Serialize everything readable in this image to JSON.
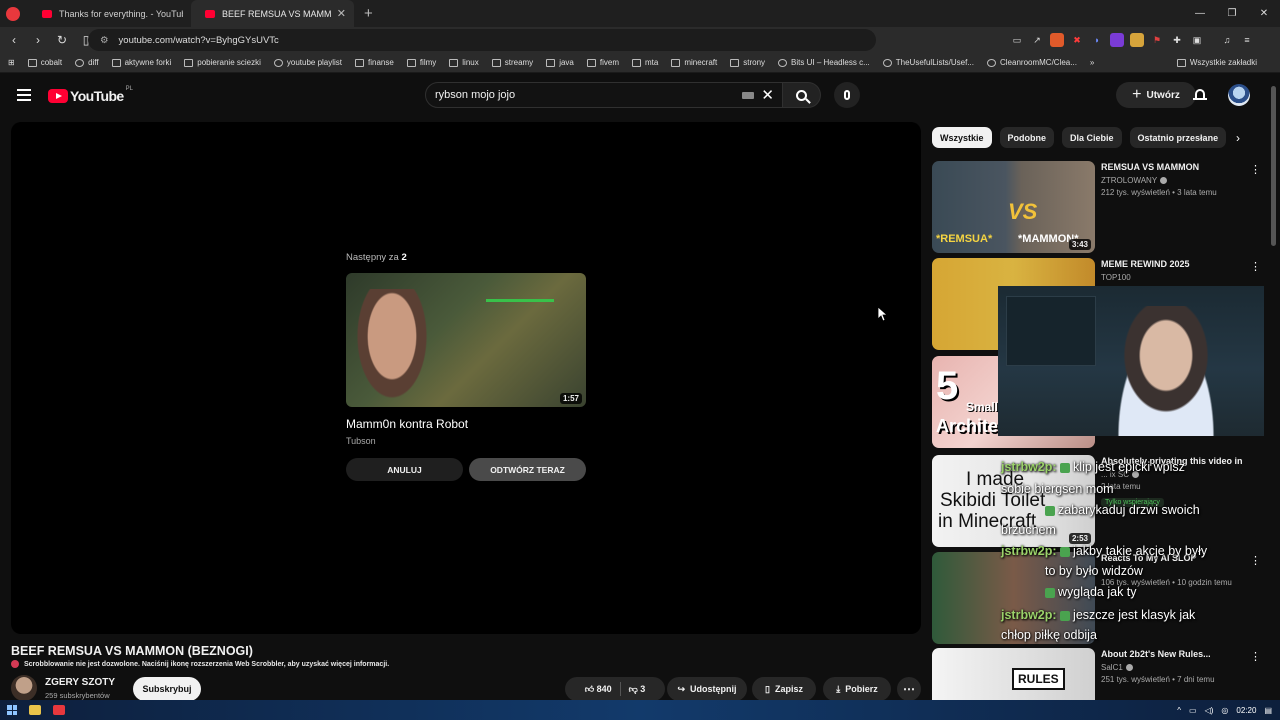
{
  "browser": {
    "tabs": [
      {
        "title": "Thanks for everything. - YouTube",
        "active": false
      },
      {
        "title": "BEEF REMSUA VS MAMMON (BE",
        "active": true
      }
    ],
    "url": "youtube.com/watch?v=ByhgGYsUVTc",
    "bookmarks": [
      "cobalt",
      "diff",
      "aktywne forki",
      "pobieranie sciezki",
      "youtube playlist",
      "finanse",
      "filmy",
      "linux",
      "streamy",
      "java",
      "fivem",
      "mta",
      "minecraft",
      "strony",
      "Bits UI – Headless c...",
      "TheUsefulLists/Usef...",
      "CleanroomMC/Clea..."
    ],
    "all_bookmarks": "Wszystkie zakładki"
  },
  "header": {
    "logo": "YouTube",
    "region": "PL",
    "search_value": "rybson mojo jojo",
    "create_label": "Utwórz"
  },
  "player": {
    "upnext_label": "Następny za",
    "upnext_count": "2",
    "next_title": "Mamm0n kontra Robot",
    "next_channel": "Tubson",
    "next_duration": "1:57",
    "cancel_label": "ANULUJ",
    "play_now_label": "ODTWÓRZ TERAZ"
  },
  "video": {
    "title": "BEEF REMSUA VS MAMMON (BEZNOGI)",
    "scrobble_notice": "Scrobblowanie nie jest dozwolone. Naciśnij ikonę rozszerzenia Web Scrobbler, aby uzyskać więcej informacji.",
    "channel": "ZGERY SZOTY",
    "subscribers": "259 subskrybentów",
    "subscribe_label": "Subskrybuj",
    "likes": "840",
    "dislikes": "3",
    "share_label": "Udostępnij",
    "save_label": "Zapisz",
    "download_label": "Pobierz"
  },
  "chips": [
    "Wszystkie",
    "Podobne",
    "Dla Ciebie",
    "Ostatnio przesłane"
  ],
  "recommendations": [
    {
      "title": "REMSUA VS MAMMON",
      "channel": "ZTROLOWANY",
      "meta": "212 tys. wyświetleń • 3 lata temu",
      "duration": "3:43",
      "thumb_text_1": "*REMSUA*",
      "thumb_text_2": "*MAMMON*",
      "thumb_text_3": "VS"
    },
    {
      "title": "MEME REWIND 2025",
      "channel": "TOP100",
      "meta": "",
      "duration": ""
    },
    {
      "title": "",
      "channel": "",
      "meta": "",
      "duration": "",
      "thumb_text_1": "5",
      "thumb_text_2": "Small",
      "thumb_text_3": "Architec"
    },
    {
      "title": "Absolutely privating this video in",
      "channel": "... ix SC",
      "meta": "2 lata temu",
      "badge": "Tylko wspierający",
      "duration": "2:53",
      "thumb_text_1": "I made",
      "thumb_text_2": "Skibidi Toilet",
      "thumb_text_3": "in Minecraft"
    },
    {
      "title": "Reacts To My AI SLOP",
      "channel": "",
      "meta": "106 tys. wyświetleń • 10 godzin temu",
      "duration": ""
    },
    {
      "title": "About 2b2t's New Rules...",
      "channel": "SalC1",
      "meta": "251 tys. wyświetleń • 7 dni temu",
      "duration": "",
      "thumb_text_1": "RULES"
    }
  ],
  "chat": [
    {
      "user": "jstrbw2p:",
      "text": "klip jest epicki wpisz"
    },
    {
      "user": "",
      "text": "sobie biergsen mom"
    },
    {
      "user": "",
      "text": "zabarykaduj drzwi swoich"
    },
    {
      "user": "",
      "text": "brzuchem"
    },
    {
      "user": "jstrbw2p:",
      "text": "jakby takie akcje by były"
    },
    {
      "user": "",
      "text": "to by było widzów"
    },
    {
      "user": "",
      "text": "wygląda jak ty"
    },
    {
      "user": "jstrbw2p:",
      "text": "jeszcze jest klasyk jak"
    },
    {
      "user": "",
      "text": "chłop piłkę odbija"
    }
  ],
  "taskbar": {
    "time": "02:20"
  },
  "colors": {
    "brand": "#ff0033",
    "background": "#0f0f0f",
    "chip_active": "#f1f1f1",
    "chat_user": "#9bd26a"
  }
}
